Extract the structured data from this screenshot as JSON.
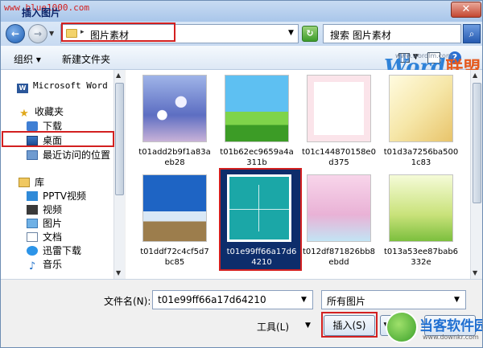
{
  "window": {
    "title": "插入图片",
    "watermark_site": "www.blue1000.com",
    "close_label": "✕"
  },
  "nav": {
    "back_icon": "arrow-left-icon",
    "forward_icon": "arrow-right-icon",
    "address": "图片素材",
    "search_placeholder": "搜索 图片素材"
  },
  "toolbar": {
    "organize": "组织 ▾",
    "new_folder": "新建文件夹"
  },
  "sidebar": {
    "items": [
      {
        "label": "Microsoft Word",
        "icon": "word-icon"
      },
      {
        "label": "收藏夹",
        "icon": "star-icon"
      },
      {
        "label": "下载",
        "icon": "download-folder-icon"
      },
      {
        "label": "桌面",
        "icon": "desktop-icon"
      },
      {
        "label": "最近访问的位置",
        "icon": "recent-places-icon"
      },
      {
        "label": "库",
        "icon": "library-icon"
      },
      {
        "label": "PPTV视频",
        "icon": "pptv-icon"
      },
      {
        "label": "视频",
        "icon": "video-icon"
      },
      {
        "label": "图片",
        "icon": "pictures-icon"
      },
      {
        "label": "文档",
        "icon": "documents-icon"
      },
      {
        "label": "迅雷下载",
        "icon": "xunlei-icon"
      },
      {
        "label": "音乐",
        "icon": "music-icon"
      }
    ]
  },
  "files": [
    {
      "name": "t01add2b9f1a83aeb28",
      "label1": "t01add2b9f1a83a",
      "label2": "eb28"
    },
    {
      "name": "t01b62ec9659a4a311b",
      "label1": "t01b62ec9659a4a",
      "label2": "311b"
    },
    {
      "name": "t01c14487015Be0d375",
      "label1": "t01c144870158e0",
      "label2": "d375"
    },
    {
      "name": "t01d3a7256ba5001c83",
      "label1": "t01d3a7256ba500",
      "label2": "1c83"
    },
    {
      "name": "t01ddf72c4cf5d7bc85",
      "label1": "t01ddf72c4cf5d7",
      "label2": "bc85"
    },
    {
      "name": "t01e99ff66a17d64210",
      "label1": "t01e99ff66a17d6",
      "label2": "4210"
    },
    {
      "name": "t012df871826bb8ebdd",
      "label1": "t012df871826bb8",
      "label2": "ebdd"
    },
    {
      "name": "t013a53ee87bab6332e",
      "label1": "t013a53ee87bab6",
      "label2": "332e"
    }
  ],
  "bottom": {
    "filename_label": "文件名(N):",
    "filename_value": "t01e99ff66a17d64210",
    "filetype_value": "所有图片",
    "tools_label": "工具(L)",
    "insert_label": "插入(S)"
  },
  "logos": {
    "word_logo": "Word",
    "word_logo_union": "联盟",
    "word_logo_url": "www.wordlm.com",
    "bottom_logo": "当客软件园",
    "bottom_logo_url": "www.downkr.com"
  },
  "colors": {
    "highlight": "#d32020",
    "selected_tile": "#0d2d6b"
  }
}
